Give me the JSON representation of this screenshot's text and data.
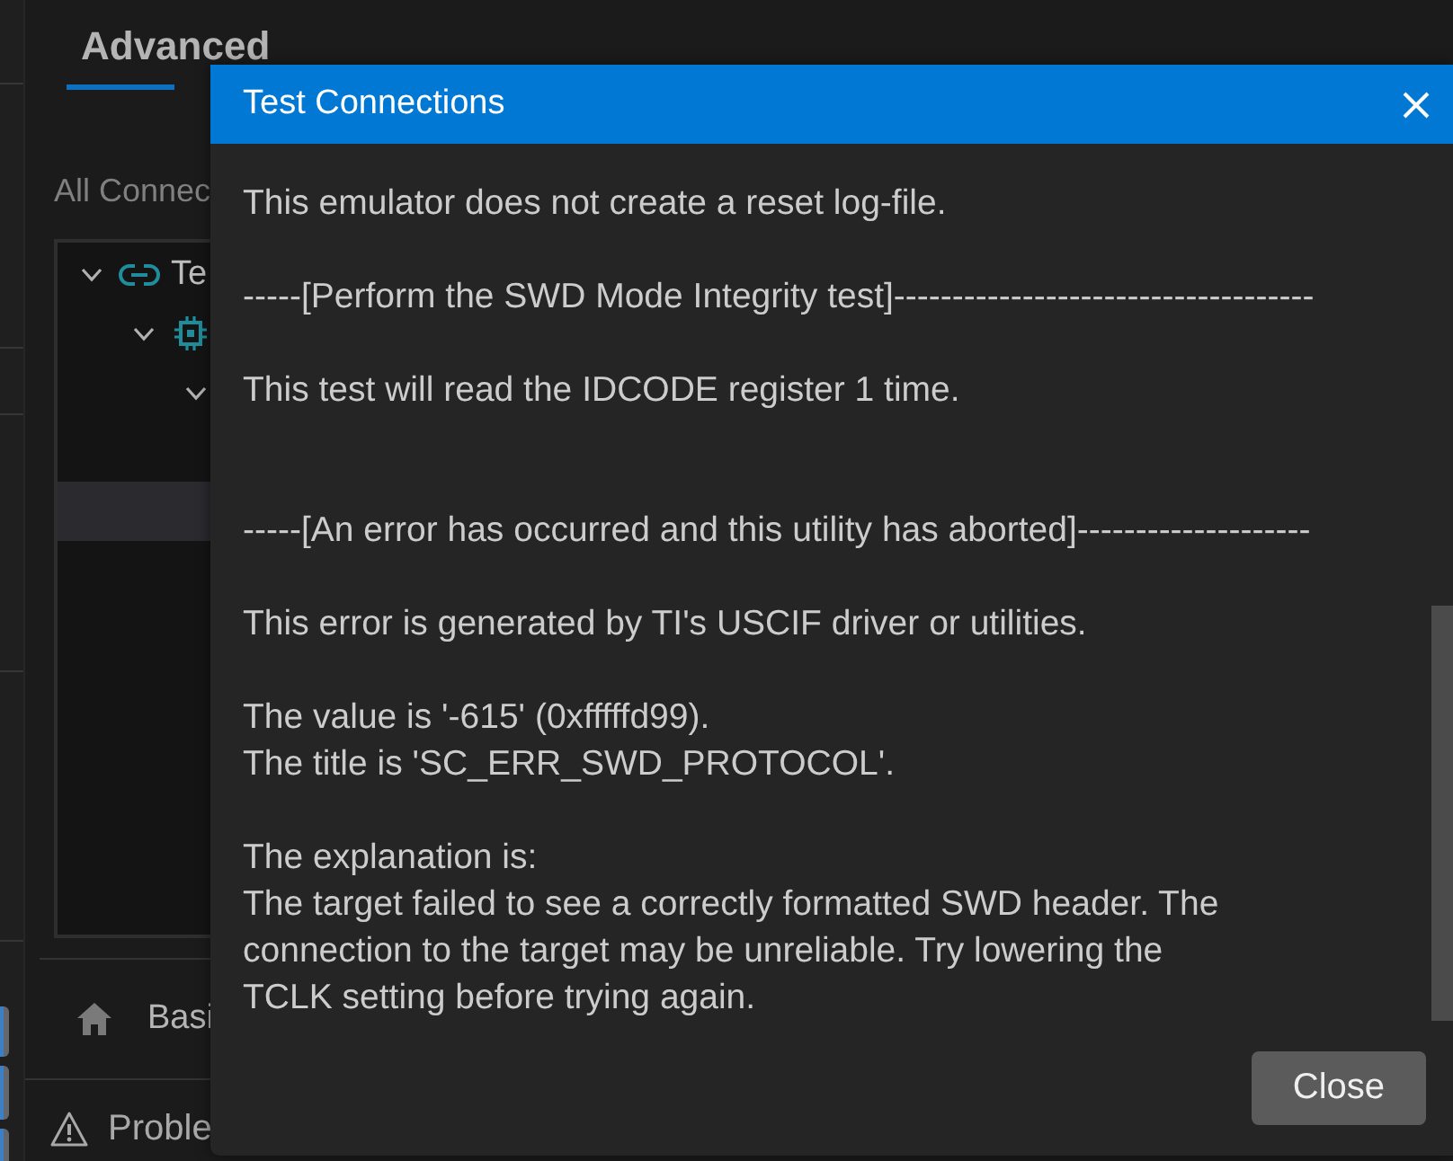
{
  "tabs": [
    {
      "label": "Advanced",
      "selected": true
    }
  ],
  "connections_label": "All Connec",
  "tree": [
    {
      "label": "Te",
      "kind": "connection",
      "expanded": true,
      "selected": false,
      "children": [
        {
          "kind": "device",
          "expanded": true,
          "selected": false,
          "children": [
            {
              "expanded": true,
              "selected": false,
              "children": [
                {
                  "selected": false
                },
                {
                  "selected": true
                }
              ]
            }
          ]
        }
      ]
    }
  ],
  "nav_item": {
    "label": "Basi"
  },
  "panel_tab": {
    "label": "Proble"
  },
  "dialog": {
    "title": "Test Connections",
    "log": "This emulator does not create a reset log-file.\n\n-----[Perform the SWD Mode Integrity test]------------------------------------\n\nThis test will read the IDCODE register 1 time.\n\n\n-----[An error has occurred and this utility has aborted]--------------------\n\nThis error is generated by TI's USCIF driver or utilities.\n\nThe value is '-615' (0xfffffd99).\nThe title is 'SC_ERR_SWD_PROTOCOL'.\n\nThe explanation is:\nThe target failed to see a correctly formatted SWD header. The\nconnection to the target may be unreliable. Try lowering the\nTCLK setting before trying again.",
    "buttons": [
      "Close"
    ]
  }
}
